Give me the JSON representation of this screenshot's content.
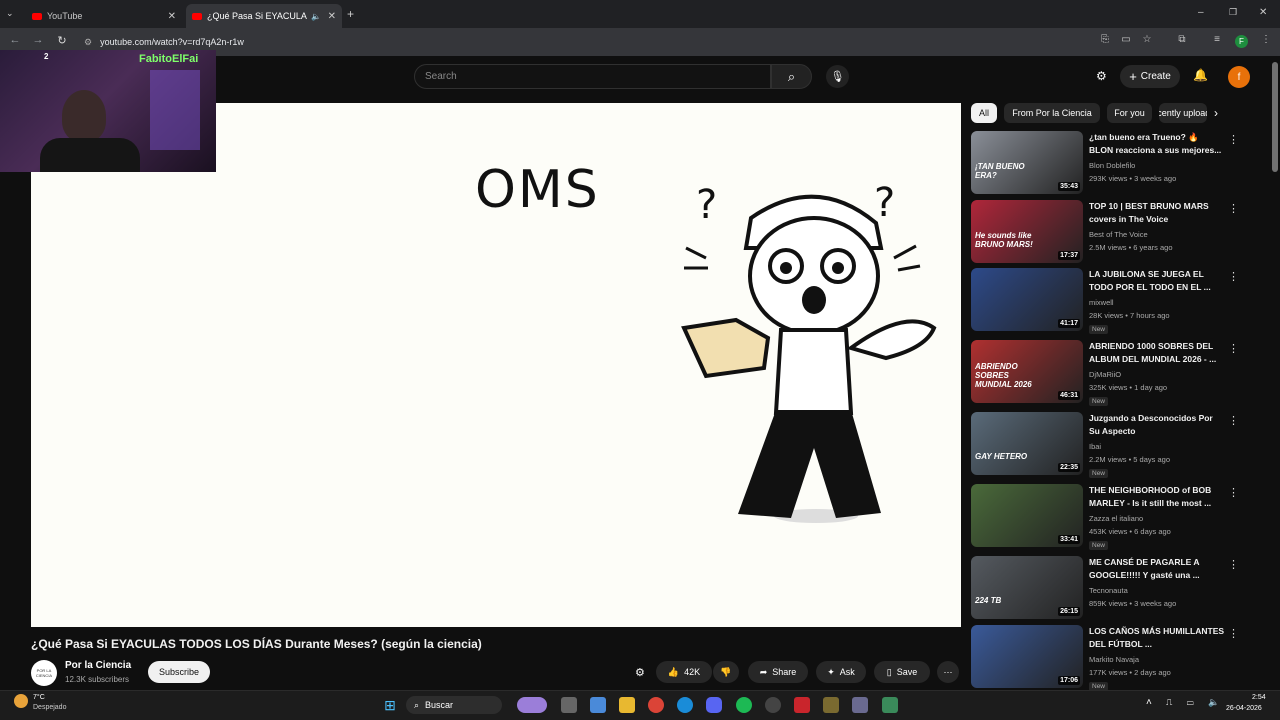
{
  "browser": {
    "tabs": [
      {
        "label": "YouTube"
      },
      {
        "label": "¿Qué Pasa Si EYACULAS TO"
      }
    ],
    "url": "youtube.com/watch?v=rd7qA2n-r1w",
    "profile_initial": "F"
  },
  "header": {
    "search_placeholder": "Search",
    "create_label": "Create",
    "avatar_initial": "f",
    "notif_icon": "bell-icon"
  },
  "webcam": {
    "overlay_name": "FabitoElFai",
    "badge": "2"
  },
  "player": {
    "frame_text": "OMS"
  },
  "video": {
    "title": "¿Qué Pasa Si EYACULAS TODOS LOS DÍAS Durante Meses? (según la ciencia)",
    "channel": "Por la Ciencia",
    "channel_avatar_text": "POR LA CIENCIA",
    "subscribers": "12.3K subscribers",
    "subscribe_label": "Subscribe",
    "likes": "42K",
    "share_label": "Share",
    "ask_label": "Ask",
    "save_label": "Save"
  },
  "chips": [
    "All",
    "From Por la Ciencia",
    "For you",
    "Recently uploaded"
  ],
  "recommended": [
    {
      "title": "¿tan bueno era Trueno? 🔥 BLON reacciona a sus mejores...",
      "channel": "Blon Doblefilo",
      "meta": "293K views • 3 weeks ago",
      "duration": "35:43",
      "thumb_text": "¡TAN BUENO ERA?",
      "color": "#8a8f98",
      "new": ""
    },
    {
      "title": "TOP 10 | BEST BRUNO MARS covers in The Voice",
      "channel": "Best of The Voice",
      "meta": "2.5M views • 6 years ago",
      "duration": "17:37",
      "thumb_text": "He sounds like BRUNO MARS!",
      "color": "#b0263a",
      "new": ""
    },
    {
      "title": "LA JUBILONA SE JUEGA EL TODO POR EL TODO EN EL ...",
      "channel": "mixwell",
      "meta": "28K views • 7 hours ago",
      "duration": "41:17",
      "thumb_text": "",
      "color": "#2d4a8a",
      "new": "New"
    },
    {
      "title": "ABRIENDO 1000 SOBRES DEL ALBUM DEL MUNDIAL 2026 - ...",
      "channel": "DjMaRiiO",
      "meta": "325K views • 1 day ago",
      "duration": "46:31",
      "thumb_text": "ABRIENDO SOBRES MUNDIAL 2026",
      "color": "#b03030",
      "new": "New"
    },
    {
      "title": "Juzgando a Desconocidos Por Su Aspecto",
      "channel": "Ibai",
      "meta": "2.2M views • 5 days ago",
      "duration": "22:35",
      "thumb_text": "GAY HETERO",
      "color": "#5a6b7a",
      "new": "New"
    },
    {
      "title": "THE NEIGHBORHOOD of BOB MARLEY - Is it still the most ...",
      "channel": "Zazza el italiano",
      "meta": "453K views • 6 days ago",
      "duration": "33:41",
      "thumb_text": "",
      "color": "#4a6a3a",
      "new": "New"
    },
    {
      "title": "ME CANSÉ DE PAGARLE A GOOGLE!!!!! Y gasté una ...",
      "channel": "Tecnonauta",
      "meta": "859K views • 3 weeks ago",
      "duration": "26:15",
      "thumb_text": "224 TB",
      "color": "#555a60",
      "new": ""
    },
    {
      "title": "LOS CAÑOS MÁS HUMILLANTES DEL FÚTBOL ...",
      "channel": "Markito Navaja",
      "meta": "177K views • 2 days ago",
      "duration": "17:06",
      "thumb_text": "",
      "color": "#3a5a9a",
      "new": "New"
    }
  ],
  "taskbar": {
    "temp": "7°C",
    "weather": "Despejado",
    "search_label": "Buscar",
    "time": "2:54",
    "date": "26-04-2026"
  }
}
